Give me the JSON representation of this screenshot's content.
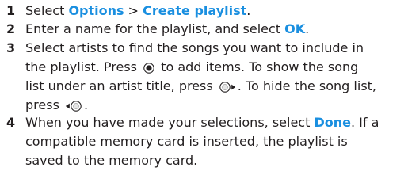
{
  "steps": [
    {
      "number": "1",
      "t1": "Select ",
      "ui1": "Options",
      "t2": " > ",
      "ui2": "Create playlist",
      "t3": "."
    },
    {
      "number": "2",
      "t1": "Enter a name for the playlist, and select ",
      "ui1": "OK",
      "t2": "."
    },
    {
      "number": "3",
      "line1": "Select artists to find the songs you want to include in",
      "l2a": "the playlist. Press ",
      "l2b": " to add items. To show the song",
      "l3a": "list under an artist title, press ",
      "l3b": ". To hide the song list,",
      "l4a": "press ",
      "l4b": "."
    },
    {
      "number": "4",
      "l1a": "When you have made your selections, select ",
      "l1ui": "Done",
      "l1b": ". If a",
      "line2": "compatible memory card is inserted, the playlist is",
      "line3": "saved to the memory card."
    }
  ],
  "icons": {
    "select_key": "joystick-center-press-icon",
    "right_key": "joystick-right-icon",
    "left_key": "joystick-left-icon"
  },
  "colors": {
    "text": "#231f20",
    "ui_term": "#1a8fe0"
  }
}
